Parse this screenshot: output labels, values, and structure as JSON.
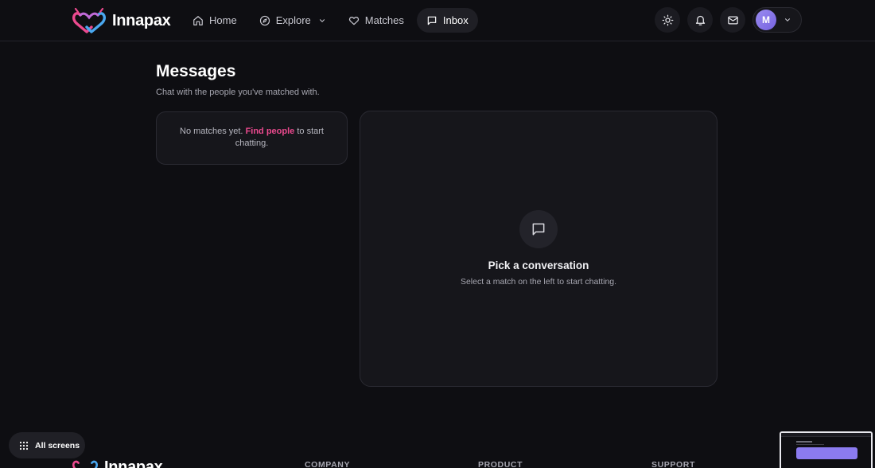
{
  "brand": {
    "name": "Innapax"
  },
  "nav": {
    "home": "Home",
    "explore": "Explore",
    "matches": "Matches",
    "inbox": "Inbox"
  },
  "profile": {
    "initial": "M"
  },
  "messages": {
    "title": "Messages",
    "subtitle": "Chat with the people you've matched with."
  },
  "empty_state": {
    "prefix": "No matches yet.",
    "link": "Find people",
    "suffix": "to start chatting."
  },
  "conversation": {
    "title": "Pick a conversation",
    "subtitle": "Select a match on the left to start chatting."
  },
  "all_screens": "All screens",
  "footer": {
    "brand": "Innapax",
    "company": "COMPANY",
    "product": "PRODUCT",
    "support": "SUPPORT"
  },
  "colors": {
    "background": "#0e0e12",
    "card": "#16161b",
    "accent_pink": "#ec4a8f",
    "accent_blue": "#4aa8f0",
    "avatar": "#8b7bf0"
  },
  "icons": {
    "home": "home-icon",
    "explore": "compass-icon",
    "matches": "heart-icon",
    "inbox": "message-square-icon",
    "theme": "sun-icon",
    "notifications": "bell-icon",
    "mail": "mail-icon",
    "all_screens": "grid-icon"
  }
}
